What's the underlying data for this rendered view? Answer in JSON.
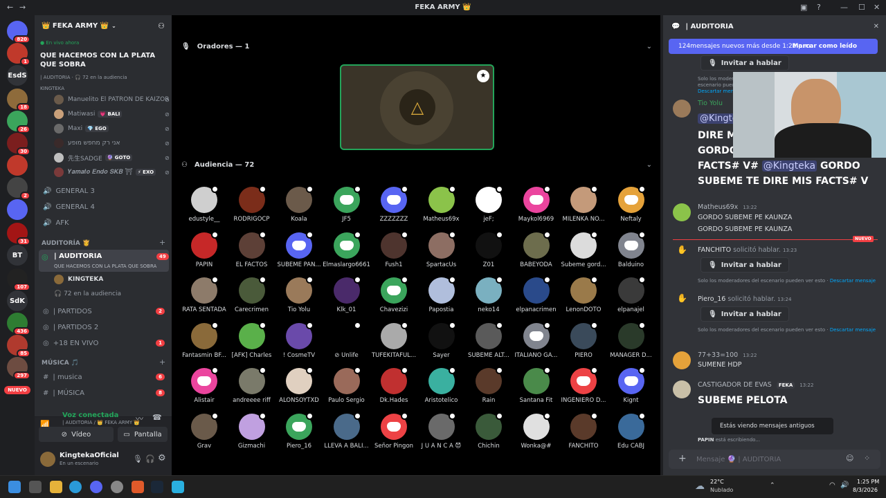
{
  "window": {
    "title": "FEKA ARMY 👑"
  },
  "rail": [
    {
      "label": "",
      "badge": "820",
      "color": "#5865f2"
    },
    {
      "label": "",
      "badge": "1",
      "color": "#c0392b"
    },
    {
      "label": "EsdS",
      "badge": "",
      "color": "#313338"
    },
    {
      "label": "",
      "badge": "18",
      "color": "#8e6b3b"
    },
    {
      "label": "",
      "badge": "26",
      "color": "#3ba55c"
    },
    {
      "label": "",
      "badge": "30",
      "color": "#7b1e1e"
    },
    {
      "label": "",
      "badge": "",
      "color": "#c0392b"
    },
    {
      "label": "",
      "badge": "2",
      "color": "#444"
    },
    {
      "label": "",
      "badge": "",
      "color": "#5865f2"
    },
    {
      "label": "",
      "badge": "31",
      "color": "#a31515"
    },
    {
      "label": "BT",
      "badge": "",
      "color": "#313338"
    },
    {
      "label": "",
      "badge": "107",
      "color": "#222"
    },
    {
      "label": "SdK",
      "badge": "",
      "color": "#313338"
    },
    {
      "label": "",
      "badge": "436",
      "color": "#2e7d32"
    },
    {
      "label": "",
      "badge": "85",
      "color": "#b03a2e"
    },
    {
      "label": "",
      "badge": "297",
      "color": "#6d4c41"
    }
  ],
  "rail_new": "NUEVO",
  "server": {
    "name": "👑 FEKA ARMY 👑"
  },
  "live": {
    "label": "En vivo ahora",
    "title": "QUE HACEMOS CON LA PLATA QUE SOBRA",
    "meta": "| AUDITORIA · 🎧 72 en la audiencia",
    "host": "KINGTEKA"
  },
  "voice_users": [
    {
      "name": "Manuelito El PATRON DE KAIZOR",
      "tag": ""
    },
    {
      "name": "Matiwasi",
      "tag": "💗 BALI"
    },
    {
      "name": "Maxi",
      "tag": "💎 EGO"
    },
    {
      "name": "אני רק מחפש מופע",
      "tag": ""
    },
    {
      "name": "先生SADGE",
      "tag": "🔮 GOTO"
    },
    {
      "name": "𝒀𝒂𝒎𝒂𝒕𝒐 𝑬𝒏𝒅𝒐 𝑺𝑲𝑩 ⛩",
      "tag": "⚡ EXO"
    }
  ],
  "channels_a": [
    {
      "name": "GENERAL 3"
    },
    {
      "name": "GENERAL 4"
    },
    {
      "name": "AFK"
    }
  ],
  "cat_auditoria": "AUDITORÍA 👸",
  "auditoria": {
    "name": "| AUDITORIA",
    "badge": "49",
    "sub": "QUE HACEMOS CON LA PLATA QUE SOBRA",
    "speaker": "KINGTEKA",
    "audience": "72 en la audiencia"
  },
  "channels_b": [
    {
      "name": "| PARTIDOS",
      "badge": "2"
    },
    {
      "name": "| PARTIDOS 2",
      "badge": ""
    },
    {
      "name": "+18 EN VIVO",
      "badge": "1"
    }
  ],
  "cat_musica": "MÚSICA 🎵",
  "channels_c": [
    {
      "name": "| musica",
      "badge": "6"
    },
    {
      "name": "| MÚSICA",
      "badge": "8"
    }
  ],
  "voice_panel": {
    "status": "Voz conectada",
    "where": "| AUDITORIA / 👑 FEKA ARMY 👑",
    "video": "Vídeo",
    "screen": "Pantalla",
    "username": "KingtekaOficial",
    "userstatus": "En un escenario"
  },
  "stage": {
    "speakers_header": "Oradores — 1",
    "audience_header": "Audiencia — 72",
    "audience": [
      {
        "name": "edustyle__",
        "color": "#cfcfcf"
      },
      {
        "name": "RODRIGOCP",
        "color": "#7b2d1a"
      },
      {
        "name": "Koala",
        "color": "#6b5a4a"
      },
      {
        "name": "JF5",
        "color": "#3ba55c"
      },
      {
        "name": "ZZZZZZZ",
        "color": "#5865f2"
      },
      {
        "name": "Matheus69x",
        "color": "#8bc34a"
      },
      {
        "name": "jeF;",
        "color": "#ffffff"
      },
      {
        "name": "Maykol6969",
        "color": "#eb459e"
      },
      {
        "name": "MILENKA NO...",
        "color": "#c49a7a"
      },
      {
        "name": "Neftaly",
        "color": "#e5a23a"
      },
      {
        "name": "PAPIN",
        "color": "#c62828"
      },
      {
        "name": "EL FACTOS",
        "color": "#5d4037"
      },
      {
        "name": "SUBEME PAN...",
        "color": "#5865f2"
      },
      {
        "name": "Elmaslargo6661",
        "color": "#3ba55c"
      },
      {
        "name": "Fush1",
        "color": "#4e342e"
      },
      {
        "name": "SpartacUs",
        "color": "#8d6e63"
      },
      {
        "name": "Z01",
        "color": "#111111"
      },
      {
        "name": "BABEYODA",
        "color": "#6d6d4d"
      },
      {
        "name": "Subeme gord...",
        "color": "#dcdcdc"
      },
      {
        "name": "Balduino",
        "color": "#80848e"
      },
      {
        "name": "RATA SENTADA",
        "color": "#8d7b6a"
      },
      {
        "name": "Carecrimen",
        "color": "#4a5a3a"
      },
      {
        "name": "Tio Yolu",
        "color": "#9a7a5a"
      },
      {
        "name": "Klk_01",
        "color": "#4a2a6a"
      },
      {
        "name": "Chavezizi",
        "color": "#3ba55c"
      },
      {
        "name": "Papostia",
        "color": "#b0bedc"
      },
      {
        "name": "neko14",
        "color": "#7ab0c0"
      },
      {
        "name": "elpanacrimen",
        "color": "#2a4a8a"
      },
      {
        "name": "LenonDOTO",
        "color": "#9a7a4a"
      },
      {
        "name": "elpanajel",
        "color": "#3a3a3a"
      },
      {
        "name": "Fantasmin BF...",
        "color": "#8a6a3a"
      },
      {
        "name": "[AFK] Charles",
        "color": "#5ab04a"
      },
      {
        "name": "! CosmeTV",
        "color": "#6a4aaa"
      },
      {
        "name": "⊘ Unlife",
        "color": "#000000"
      },
      {
        "name": "TUFEKITAFUL...",
        "color": "#aaaaaa"
      },
      {
        "name": "Sayer",
        "color": "#111111"
      },
      {
        "name": "SUBEME ALT...",
        "color": "#5a5a5a"
      },
      {
        "name": "ITALIANO GA...",
        "color": "#80848e"
      },
      {
        "name": "PIERO",
        "color": "#3a4a5a"
      },
      {
        "name": "MANAGER D...",
        "color": "#2a3a2a"
      },
      {
        "name": "Alistair",
        "color": "#eb459e"
      },
      {
        "name": "andreeee riff",
        "color": "#7a7a6a"
      },
      {
        "name": "ALONSOYTXD",
        "color": "#e0d0c0"
      },
      {
        "name": "Paulo Sergio",
        "color": "#9a6a5a"
      },
      {
        "name": "Dk.Hades",
        "color": "#c03030"
      },
      {
        "name": "Aristotelico",
        "color": "#3ab0a0"
      },
      {
        "name": "Rain",
        "color": "#5a3a2a"
      },
      {
        "name": "Santana Fit",
        "color": "#4a8a4a"
      },
      {
        "name": "INGENIERO D...",
        "color": "#ed4245"
      },
      {
        "name": "Kignt",
        "color": "#5865f2"
      },
      {
        "name": "Grav",
        "color": "#6a5a4a"
      },
      {
        "name": "Gizmachi",
        "color": "#c0a0e0"
      },
      {
        "name": "Piero_16",
        "color": "#3ba55c"
      },
      {
        "name": "LLEVA A BALI...",
        "color": "#4a6a8a"
      },
      {
        "name": "Señor Pingon",
        "color": "#ed4245"
      },
      {
        "name": "J U A N C A 😈",
        "color": "#6a6a6a"
      },
      {
        "name": "Chichin",
        "color": "#3a5a3a"
      },
      {
        "name": "Wonka@#",
        "color": "#e0e0e0"
      },
      {
        "name": "FANCHITO",
        "color": "#5a3a2a"
      },
      {
        "name": "Edu CABJ",
        "color": "#3a6a9a"
      }
    ]
  },
  "chat": {
    "channel": "| AUDITORIA",
    "newbar": "124mensajes nuevos más desde 1:22 p.m.",
    "mark_read": "Marcar como leído",
    "invite": "Invitar a hablar",
    "mod_note": "Solo los moderadores del escenario pueden ver esto ·",
    "dismiss": "Descartar mensaje",
    "tio": {
      "name": "Tio Yolu",
      "lines": [
        "DIRE M",
        "GORDO"
      ]
    },
    "mention": "@Kingteka",
    "big_line1_a": "FACTS# V#",
    "big_line1_b": "GORDO",
    "big_line2": "SUBEME TE DIRE MIS FACTS# V",
    "matheus": {
      "name": "Matheus69x",
      "time": "13:22",
      "l1": "GORDO SUBEME PE KAUNZA",
      "l2": "GORDO SUBEME PE KAUNZA"
    },
    "new_label": "NUEVO",
    "req1": {
      "name": "FANCHITO",
      "text": "solicitó hablar.",
      "time": "13:23"
    },
    "req2": {
      "name": "Piero_16",
      "text": "solicitó hablar.",
      "time": "13:24"
    },
    "m77": {
      "name": "77+33=100",
      "time": "13:22",
      "text": "SUMENE HDP"
    },
    "cast": {
      "name": "CASTIGADOR DE EVAS",
      "tag": "FEKA",
      "time": "13:22",
      "text": "SUBEME PELOTA"
    },
    "old_tip": "Estás viendo mensajes antiguos",
    "typing_name": "PAPIN",
    "typing": "está escribiendo...",
    "composer": "Mensaje 🔮 | AUDITORIA"
  },
  "taskbar": {
    "temp": "22°C",
    "weather": "Nublado",
    "time": "1:25 PM",
    "date": "8/3/2026"
  }
}
